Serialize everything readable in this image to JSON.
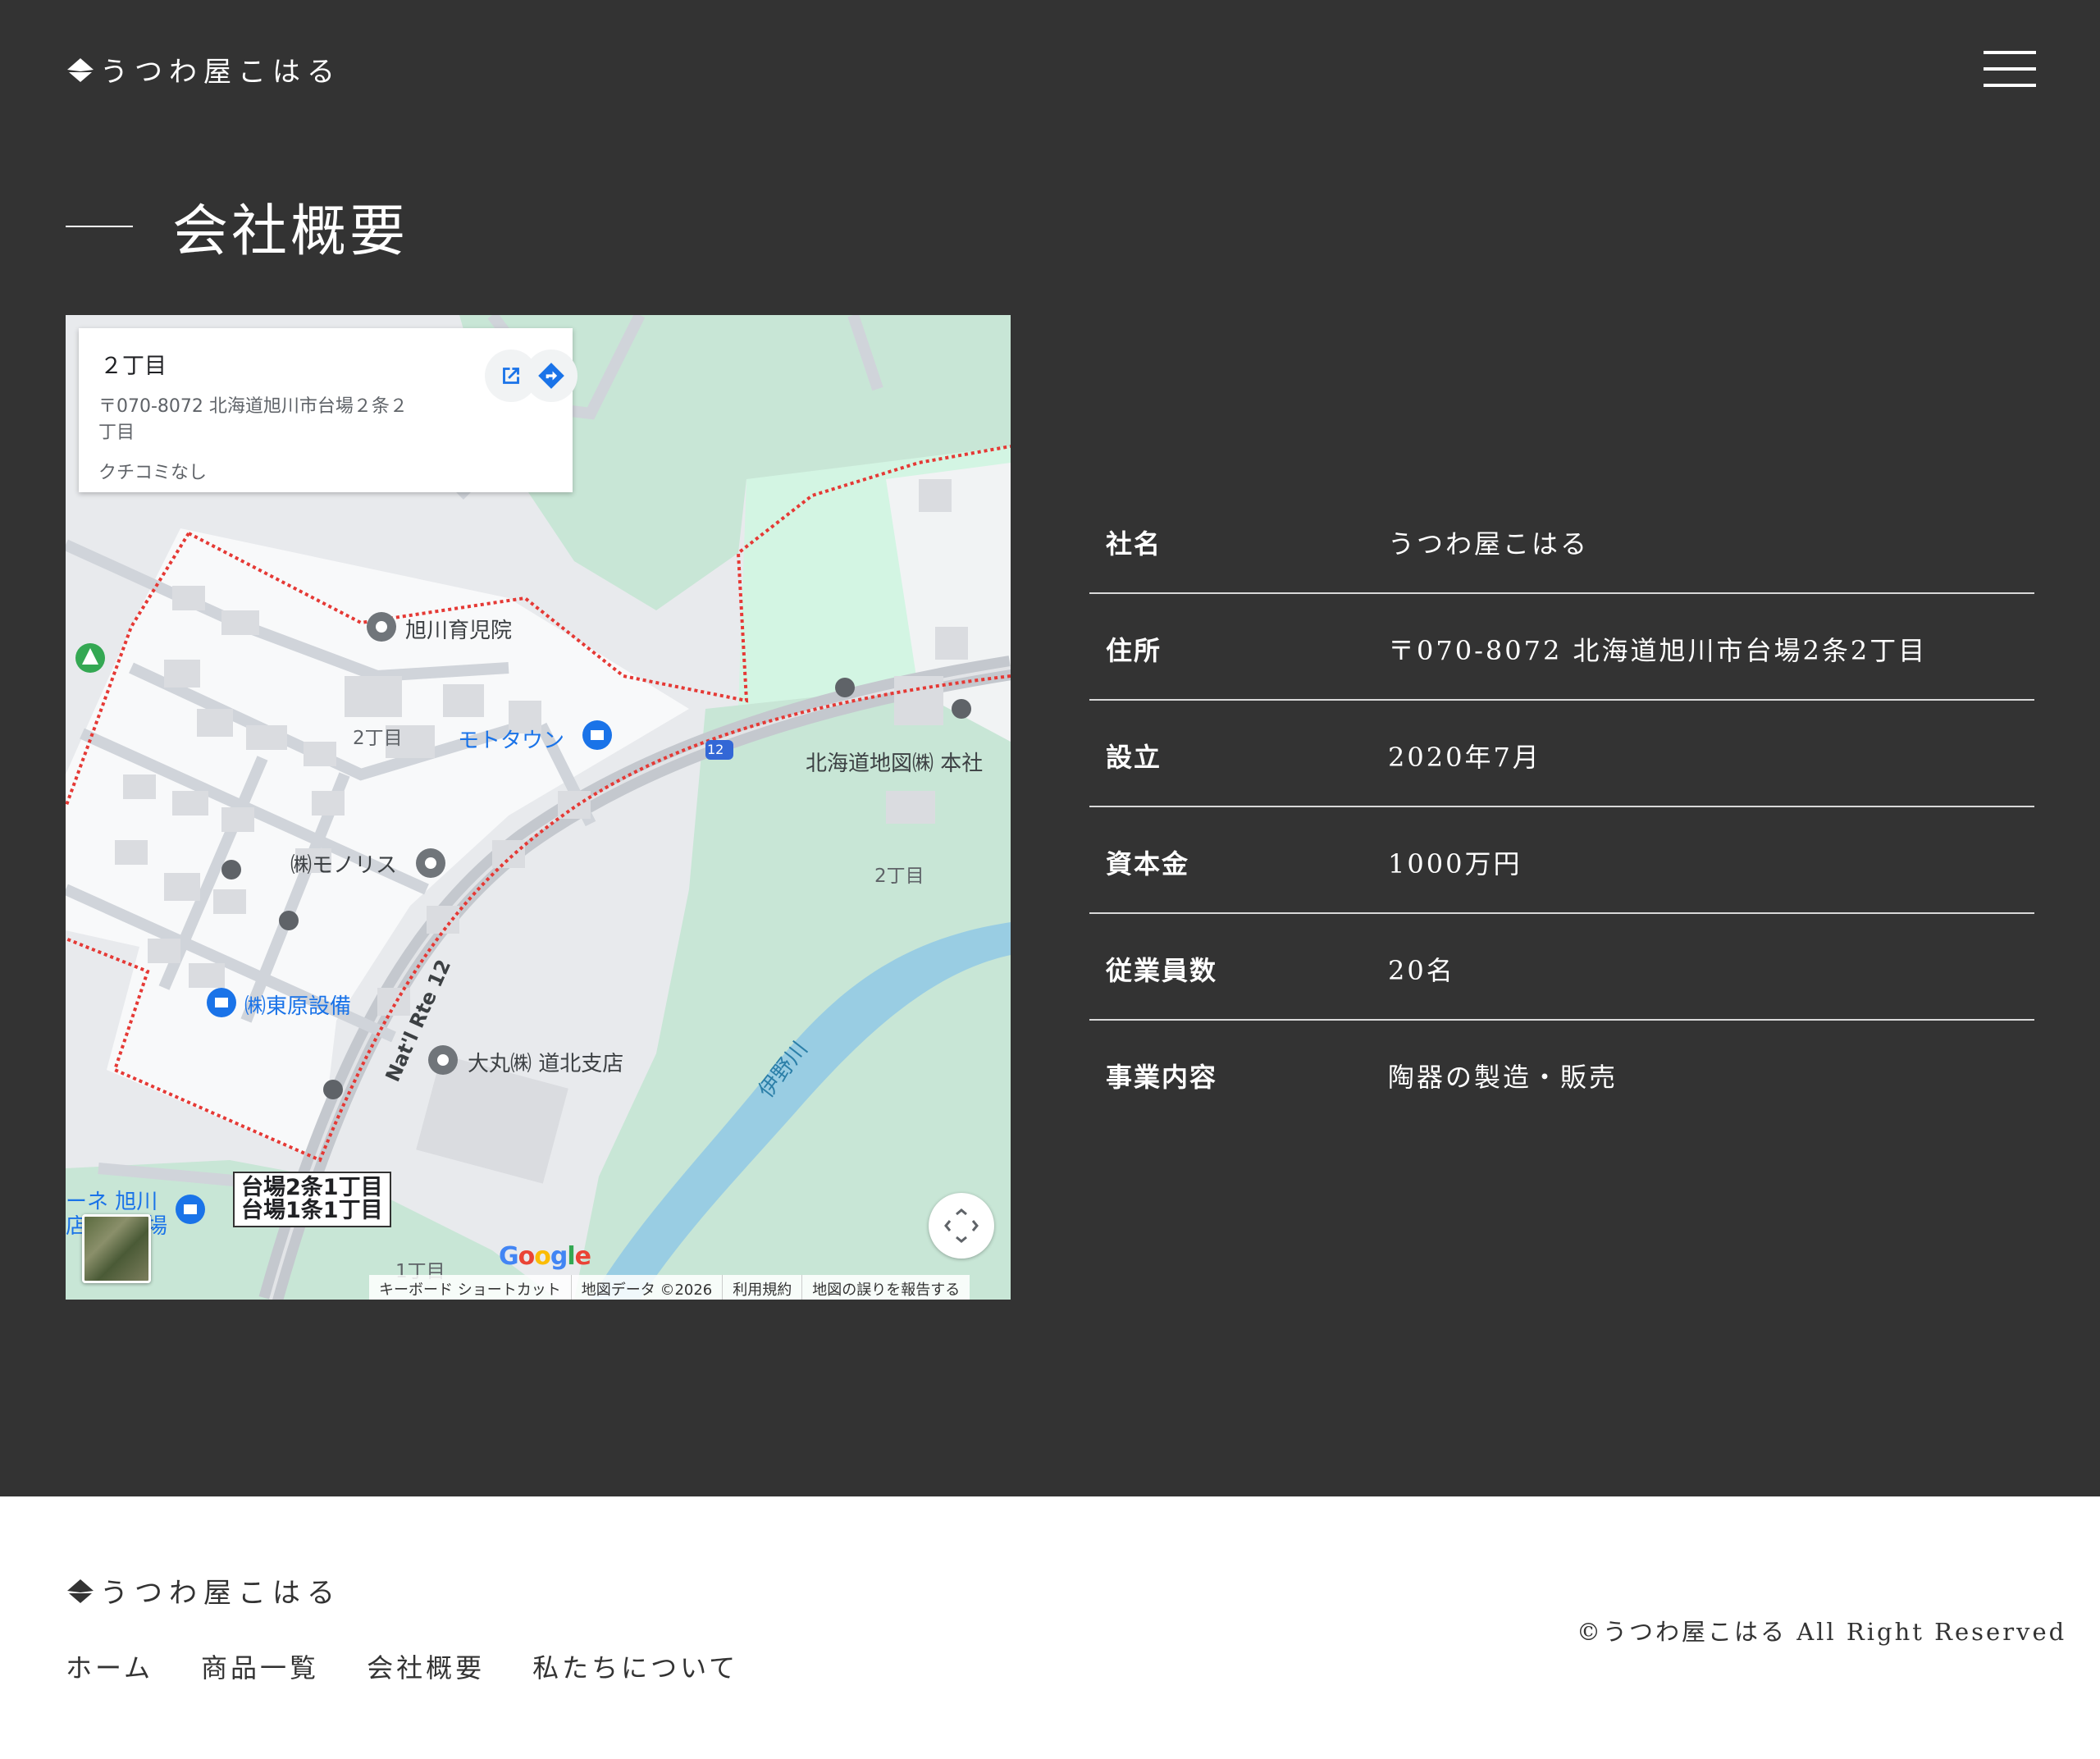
{
  "header": {
    "logo_text": "うつわ屋こはる",
    "menu_icon": "hamburger-menu-icon"
  },
  "page": {
    "title": "会社概要"
  },
  "map": {
    "info_card": {
      "title": "２丁目",
      "address": "〒070-8072 北海道旭川市台場２条２丁目",
      "reviews": "クチコミなし",
      "open_icon": "open-in-new-icon",
      "directions_icon": "directions-icon"
    },
    "labels": {
      "nursery": "旭川育児院",
      "mototown": "モトタウン",
      "hokkaido_map": "北海道地図㈱ 本社",
      "monolith": "㈱モノリス",
      "higashihara": "㈱東原設備",
      "daimaru": "大丸㈱ 道北支店",
      "chome2_a": "2丁目",
      "chome2_b": "2丁目",
      "chome1": "1丁目",
      "river": "伊野川",
      "road": "Nat'l Rte 12",
      "route_shield": "12",
      "left_shop_1": "ーネ 旭川",
      "left_shop_2": "店",
      "left_shop_3": "場"
    },
    "boxed_label": {
      "line1": "台場2条1丁目",
      "line2": "台場1条1丁目"
    },
    "google_logo": [
      "G",
      "o",
      "o",
      "g",
      "l",
      "e"
    ],
    "attribution": {
      "shortcuts": "キーボード ショートカット",
      "map_data": "地図データ ©2026",
      "terms": "利用規約",
      "report": "地図の誤りを報告する"
    }
  },
  "company_info": [
    {
      "label": "社名",
      "value": "うつわ屋こはる"
    },
    {
      "label": "住所",
      "value": "〒070-8072 北海道旭川市台場2条2丁目"
    },
    {
      "label": "設立",
      "value": "2020年7月"
    },
    {
      "label": "資本金",
      "value": "1000万円"
    },
    {
      "label": "従業員数",
      "value": "20名"
    },
    {
      "label": "事業内容",
      "value": "陶器の製造・販売"
    }
  ],
  "footer": {
    "logo_text": "うつわ屋こはる",
    "nav": [
      {
        "label": "ホーム"
      },
      {
        "label": "商品一覧"
      },
      {
        "label": "会社概要"
      },
      {
        "label": "私たちについて"
      }
    ],
    "copyright": "©うつわ屋こはる All Right Reserved"
  },
  "colors": {
    "dark_bg": "#333333",
    "light_bg": "#ffffff",
    "text_light": "#ffffff",
    "text_dark": "#333333",
    "divider": "#d9d9d9"
  }
}
